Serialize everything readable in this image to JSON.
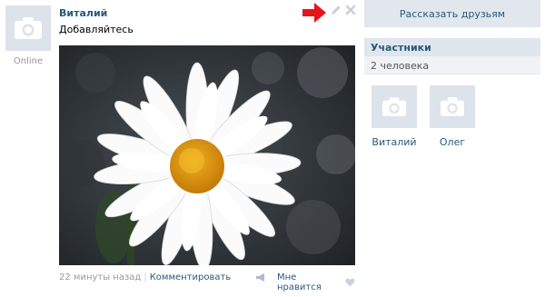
{
  "post": {
    "author": "Виталий",
    "status": "Online",
    "text": "Добавляйтесь",
    "time": "22 минуты назад",
    "separator": "|",
    "comment_label": "Комментировать",
    "like_label": "Мне нравится"
  },
  "sidebar": {
    "tell_friends_label": "Рассказать друзьям",
    "members_title": "Участники",
    "members_count": "2 человека",
    "members": [
      {
        "name": "Виталий"
      },
      {
        "name": "Олег"
      }
    ]
  },
  "icons": {
    "avatar": "camera-icon",
    "edit": "pencil-icon",
    "delete": "close-icon",
    "share": "megaphone-icon",
    "like": "heart-icon",
    "annotation": "red-arrow-icon"
  },
  "colors": {
    "link": "#2b587a",
    "header_bg": "#dfe6ed",
    "avatar_bg": "#dde3ea",
    "arrow": "#e8141c"
  }
}
